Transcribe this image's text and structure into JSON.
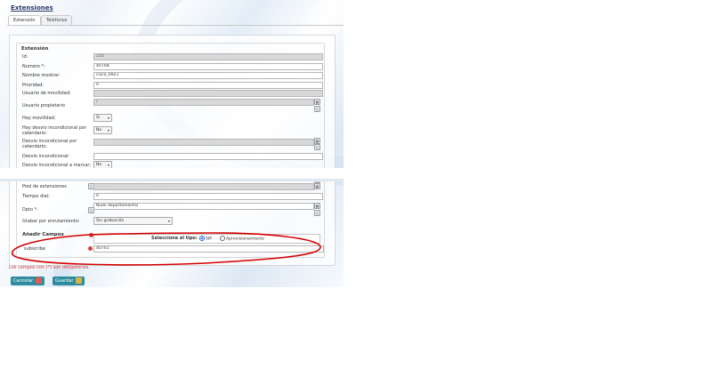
{
  "title": "Extensiones",
  "tabs": [
    {
      "label": "Extensión"
    },
    {
      "label": "Teléfonos"
    }
  ],
  "section_extension": "Extensión",
  "fields": {
    "id": {
      "label": "Id:",
      "value": "155"
    },
    "numero": {
      "label": "Numero *:",
      "value": "40708"
    },
    "nombre": {
      "label": "Nombre mostrar:",
      "value": "cisco_6921"
    },
    "prioridad": {
      "label": "Prioridad:",
      "value": "0"
    },
    "usuario_movilidad": {
      "label": "Usuario de movilidad:",
      "value": ""
    },
    "usuario_propietario": {
      "label": "Usuario propietario",
      "value": "/"
    },
    "hay_movilidad": {
      "label": "Hay movilidad:",
      "value": "Si"
    },
    "hay_desvio_calendario": {
      "label": "Hay desvio incondicional por calendario:",
      "value": "No"
    },
    "desvio_calendario": {
      "label": "Desvio incondicional por calendario:",
      "value": ""
    },
    "desvio_incondicional": {
      "label": "Desvio incondicional:",
      "value": ""
    },
    "desvio_marcar": {
      "label": "Desvio incondicional a marcar:",
      "value": "No"
    },
    "pool": {
      "label": "Pool de extensiones",
      "value": ""
    },
    "tiempo_dial": {
      "label": "Tiempo dial:",
      "value": "0"
    },
    "dpto": {
      "label": "Dpto *:",
      "value": "Nivel departamental"
    },
    "grabar": {
      "label": "Grabar por enrutamiento:",
      "value": "Sin grabación"
    }
  },
  "add_fields": {
    "legend": "Añadir Campos",
    "select_type_label": "Seleccione el tipo:",
    "type_options": [
      "SIP",
      "Aprovisionamiento"
    ],
    "selected_type": "SIP",
    "subscribe_label": "subscribe",
    "subscribe_value": "40701"
  },
  "required_note": "Los campos con (*) son obligatorios",
  "buttons": {
    "cancel": "Cancelar",
    "save": "Guardar"
  },
  "colors": {
    "accent_button": "#2f8c9e",
    "annotation": "#d40000"
  }
}
